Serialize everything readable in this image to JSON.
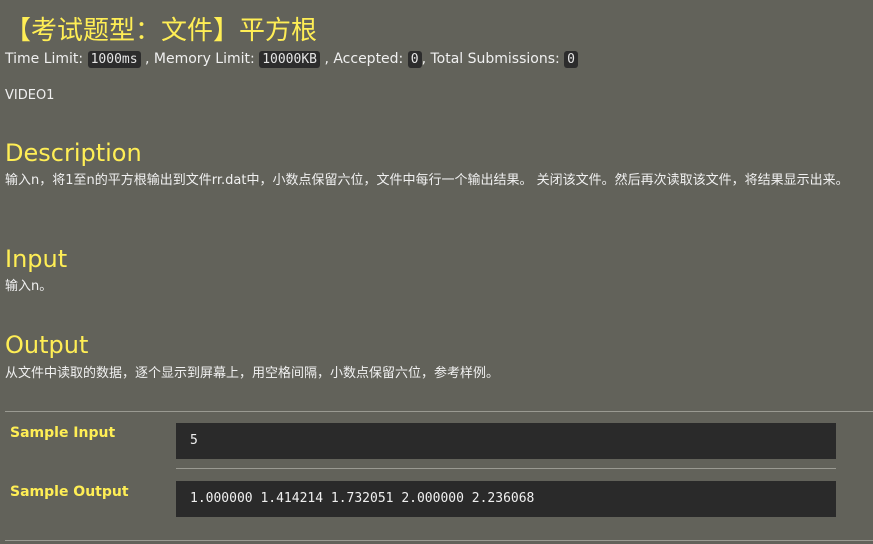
{
  "problem": {
    "title": "【考试题型：文件】平方根",
    "limits": {
      "time_label": "Time Limit:",
      "time_value": "1000ms",
      "memory_label": ", Memory Limit:",
      "memory_value": "10000KB",
      "accepted_label": ", Accepted:",
      "accepted_value": "0",
      "total_label": ", Total Submissions:",
      "total_value": "0"
    },
    "video": "VIDEO1"
  },
  "description": {
    "heading": "Description",
    "text": "输入n，将1至n的平方根输出到文件rr.dat中，小数点保留六位，文件中每行一个输出结果。 关闭该文件。然后再次读取该文件，将结果显示出来。"
  },
  "input": {
    "heading": "Input",
    "text": "输入n。"
  },
  "output": {
    "heading": "Output",
    "text": "从文件中读取的数据，逐个显示到屏幕上，用空格间隔，小数点保留六位，参考样例。"
  },
  "samples": {
    "input_label": "Sample Input",
    "input_value": "5",
    "output_label": "Sample Output",
    "output_value": "1.000000 1.414214 1.732051 2.000000 2.236068"
  },
  "colors": {
    "background": "#62625a",
    "heading": "#ffee55",
    "code_background": "#2a2a2a"
  }
}
